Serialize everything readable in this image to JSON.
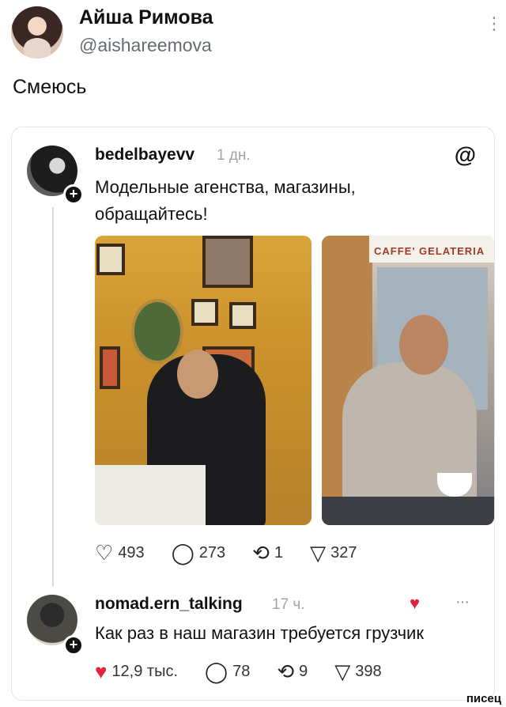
{
  "tweet": {
    "name": "Айша Римова",
    "handle": "@aishareemova",
    "text": "Смеюсь",
    "more_icon": "⋮"
  },
  "quoted": {
    "username": "bedelbayevv",
    "time": "1 дн.",
    "logo": "@",
    "text": "Модельные агенства, магазины, обращайтесь!",
    "photo2_sign": "CAFFE' GELATERIA",
    "actions": {
      "likes": "493",
      "comments": "273",
      "reposts": "1",
      "shares": "327"
    }
  },
  "reply": {
    "username": "nomad.ern_talking",
    "time": "17 ч.",
    "more": "···",
    "text": "Как раз в наш магазин требуется грузчик",
    "actions": {
      "likes": "12,9 тыс.",
      "comments": "78",
      "reposts": "9",
      "shares": "398"
    }
  },
  "icons": {
    "plus": "+",
    "heart_outline": "♡",
    "heart_filled": "♥",
    "comment": "◯",
    "repost": "⟲",
    "share": "▽",
    "reply_reaction": "♥"
  },
  "colors": {
    "like_red": "#e0243b",
    "muted": "#a0a4aa"
  },
  "watermark": "писец"
}
